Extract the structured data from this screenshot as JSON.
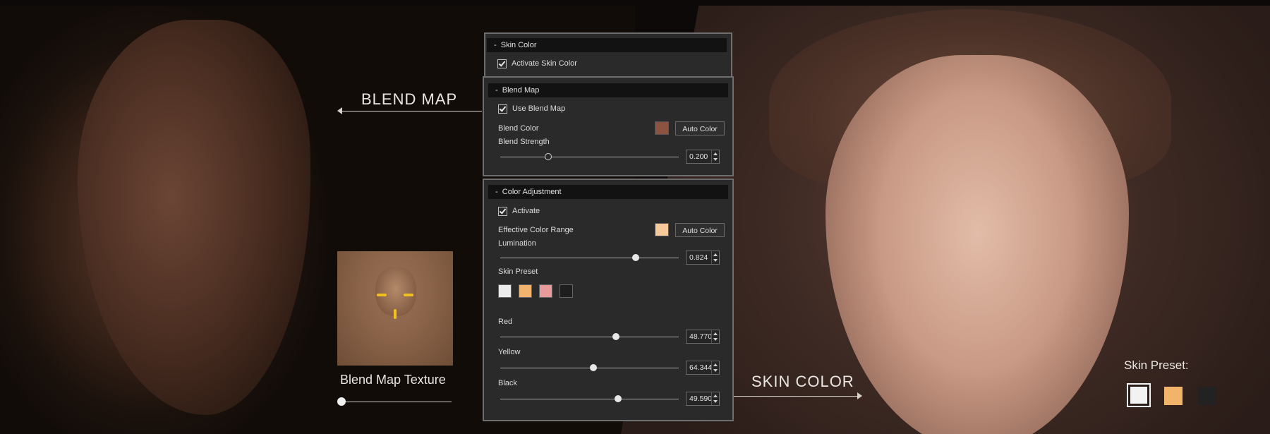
{
  "callouts": {
    "blend_map": "BLEND MAP",
    "skin_color": "SKIN COLOR",
    "texture_label": "Blend Map Texture",
    "skin_preset_label": "Skin Preset:"
  },
  "right_presets": [
    {
      "color": "#f2f2f2",
      "selected": true
    },
    {
      "color": "#f2b36b",
      "selected": false
    },
    {
      "color": "#222222",
      "selected": false
    }
  ],
  "texture_slider_value": 0,
  "panel": {
    "skin_color": {
      "header": "Skin Color",
      "activate_label": "Activate Skin Color",
      "activate_checked": true
    },
    "blend_map": {
      "header": "Blend Map",
      "use_label": "Use Blend Map",
      "use_checked": true,
      "blend_color_label": "Blend Color",
      "blend_color": "#8b5340",
      "auto_color_label": "Auto Color",
      "blend_strength_label": "Blend Strength",
      "blend_strength": "0.200",
      "blend_strength_fraction": 0.27
    },
    "color_adjustment": {
      "header": "Color Adjustment",
      "activate_label": "Activate",
      "activate_checked": true,
      "effective_range_label": "Effective Color Range",
      "effective_color": "#f5c99a",
      "auto_color_label": "Auto Color",
      "lumination_label": "Lumination",
      "lumination": "0.824",
      "lumination_fraction": 0.76,
      "skin_preset_label": "Skin Preset",
      "presets": [
        "#ececec",
        "#f0b46e",
        "#e89a9a",
        "#1e1e1e"
      ],
      "red_label": "Red",
      "red": "48.770",
      "red_fraction": 0.65,
      "yellow_label": "Yellow",
      "yellow": "64.344",
      "yellow_fraction": 0.52,
      "black_label": "Black",
      "black": "49.590",
      "black_fraction": 0.66
    }
  }
}
